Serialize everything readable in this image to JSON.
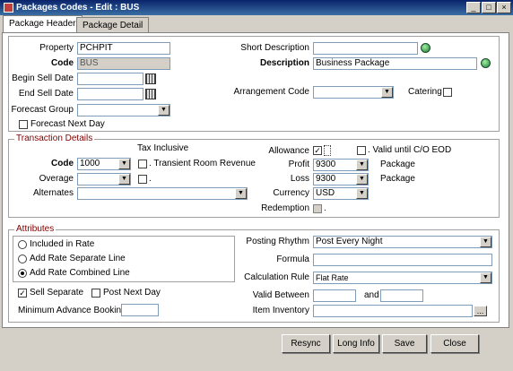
{
  "window": {
    "title": "Packages Codes - Edit : BUS",
    "min": "_",
    "max": "□",
    "close": "×"
  },
  "tabs": [
    {
      "label": "Package Header"
    },
    {
      "label": "Package Detail"
    }
  ],
  "header": {
    "property_label": "Property",
    "property_value": "PCHPIT",
    "code_label": "Code",
    "code_value": "BUS",
    "begin_sell_label": "Begin Sell Date",
    "begin_sell_value": "",
    "end_sell_label": "End Sell Date",
    "end_sell_value": "",
    "forecast_group_label": "Forecast Group",
    "forecast_group_value": "",
    "forecast_next_day_label": "Forecast Next Day",
    "short_desc_label": "Short Description",
    "short_desc_value": "",
    "description_label": "Description",
    "description_value": "Business Package",
    "arrangement_label": "Arrangement Code",
    "arrangement_value": "",
    "catering_label": "Catering"
  },
  "transaction": {
    "legend": "Transaction Details",
    "tax_inclusive_label": "Tax Inclusive",
    "code_label": "Code",
    "code_value": "1000",
    "transient_label": ". Transient Room Revenue",
    "overage_label": "Overage",
    "overage_value": "",
    "overage_dot": ".",
    "alternates_label": "Alternates",
    "alternates_value": "",
    "allowance_label": "Allowance",
    "allowance_check": "✓",
    "valid_co_label": ". Valid until C/O EOD",
    "profit_label": "Profit",
    "profit_value": "9300",
    "profit_unit": "Package",
    "loss_label": "Loss",
    "loss_value": "9300",
    "loss_unit": "Package",
    "currency_label": "Currency",
    "currency_value": "USD",
    "redemption_label": "Redemption",
    "redemption_dot": "."
  },
  "attributes": {
    "legend": "Attributes",
    "included_label": "Included in Rate",
    "separate_label": "Add Rate Separate Line",
    "combined_label": "Add Rate Combined Line",
    "sell_separate_label": "Sell Separate",
    "sell_separate_check": "✓",
    "post_next_day_label": "Post Next Day",
    "min_adv_label": "Minimum Advance Booking",
    "min_adv_value": "",
    "posting_rhythm_label": "Posting Rhythm",
    "posting_rhythm_value": "Post Every Night",
    "formula_label": "Formula",
    "formula_value": "",
    "calc_rule_label": "Calculation Rule",
    "calc_rule_value": "Flat Rate",
    "valid_between_label": "Valid Between",
    "valid_from": "",
    "and_label": "and",
    "valid_to": "",
    "item_inventory_label": "Item Inventory",
    "item_inventory_value": "",
    "item_inventory_btn": "..."
  },
  "buttons": {
    "resync": "Resync",
    "long_info": "Long Info",
    "save": "Save",
    "close": "Close"
  },
  "icons": {
    "dropdown": "▼"
  }
}
